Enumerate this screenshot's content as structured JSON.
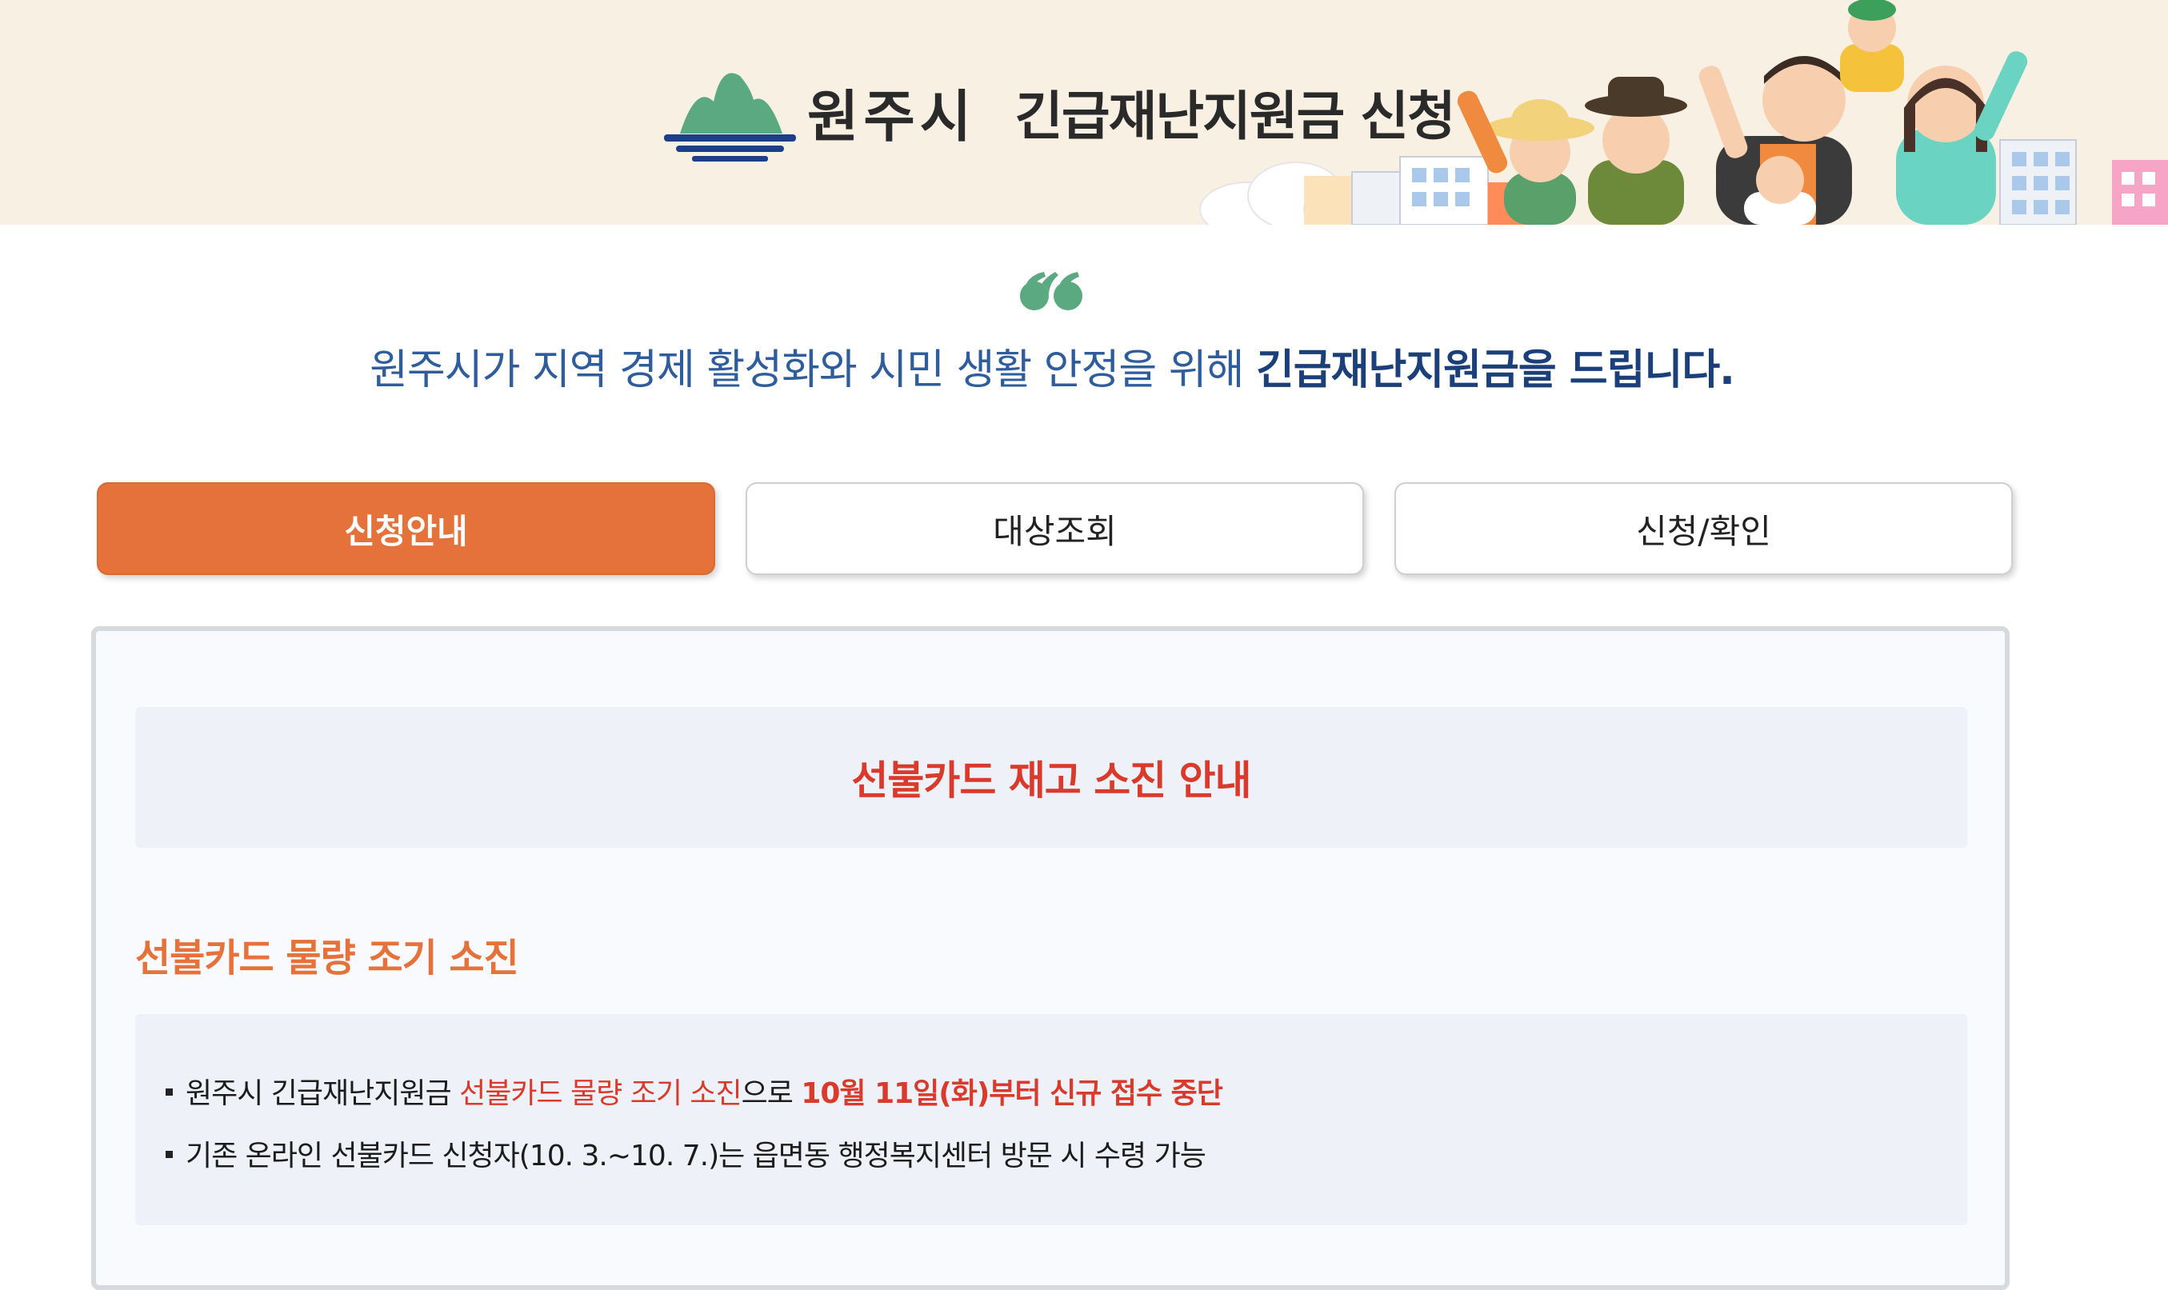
{
  "banner": {
    "city_name": "원주시",
    "title": "긴급재난지원금 신청"
  },
  "intro": {
    "text_plain": "원주시가 지역 경제 활성화와 시민 생활 안정을 위해 ",
    "text_strong": "긴급재난지원금을 드립니다."
  },
  "tabs": [
    {
      "label": "신청안내",
      "active": true
    },
    {
      "label": "대상조회",
      "active": false
    },
    {
      "label": "신청/확인",
      "active": false
    }
  ],
  "notice": {
    "title": "선불카드 재고 소진 안내"
  },
  "section": {
    "heading": "선불카드 물량 조기 소진",
    "lines": [
      {
        "part1": "원주시 긴급재난지원금 ",
        "part2": "선불카드 물량 조기 소진",
        "part3": "으로 ",
        "part4": "10월 11일(화)부터 신규 접수 중단"
      },
      {
        "text": "기존 온라인 선불카드 신청자(10. 3.~10. 7.)는 읍면동 행정복지센터 방문 시 수령 가능"
      }
    ]
  },
  "colors": {
    "accent_orange": "#e4723a",
    "notice_red": "#d93a2b",
    "intro_blue": "#2f5d9c",
    "banner_bg": "#f8f0e2"
  },
  "icons": [
    "city-logo-icon",
    "quote-icon"
  ]
}
